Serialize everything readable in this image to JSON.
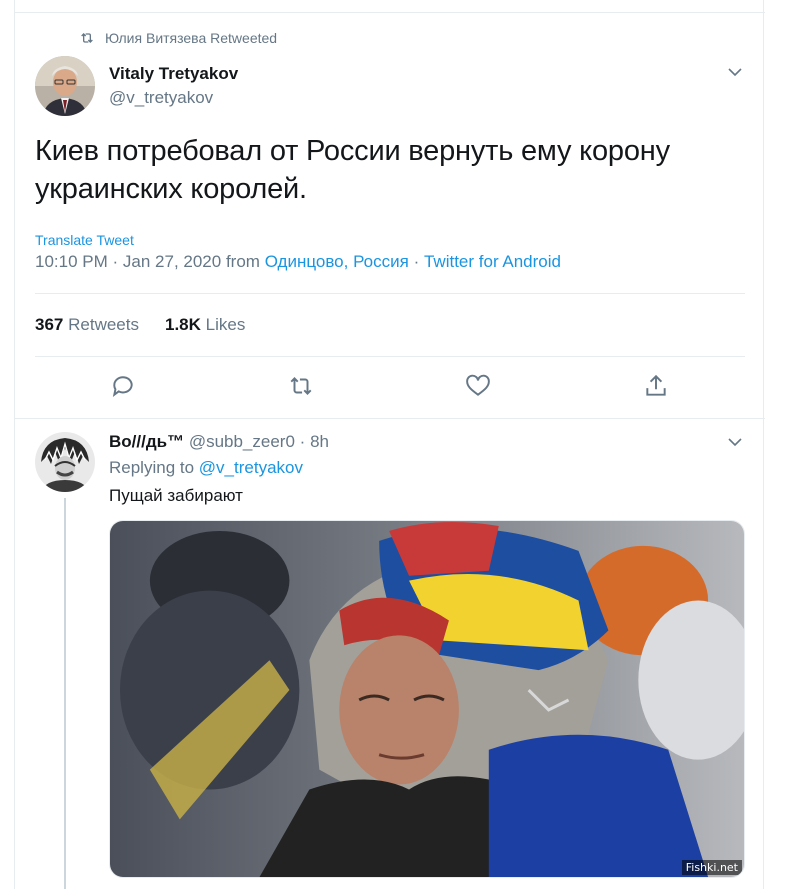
{
  "retweet_context": {
    "text": "Юлия Витязева Retweeted",
    "icon": "retweet-icon"
  },
  "main_tweet": {
    "author_name": "Vitaly Tretyakov",
    "author_handle": "@v_tretyakov",
    "text_line1": "Киев потребовал от России вернуть ему корону",
    "text_line2": "украинских королей.",
    "translate_label": "Translate Tweet",
    "time": "10:10 PM",
    "date": "Jan 27, 2020",
    "from_label": "from",
    "location": "Одинцово, Россия",
    "separator": "·",
    "client": "Twitter for Android",
    "retweets_count": "367",
    "retweets_label": "Retweets",
    "likes_count": "1.8K",
    "likes_label": "Likes"
  },
  "actions": [
    {
      "icon": "reply-icon"
    },
    {
      "icon": "retweet-icon"
    },
    {
      "icon": "like-icon"
    },
    {
      "icon": "share-icon"
    }
  ],
  "reply": {
    "author_name": "Во///дь™",
    "author_handle": "@subb_zeer0",
    "separator": "·",
    "time_ago": "8h",
    "replying_label": "Replying to",
    "replying_to": "@v_tretyakov",
    "text": "Пущай забирают"
  },
  "watermark": "Fishki.net",
  "colors": {
    "link": "#1b95e0",
    "secondary_text": "#657786",
    "primary_text": "#14171a",
    "border": "#e6ecf0"
  }
}
